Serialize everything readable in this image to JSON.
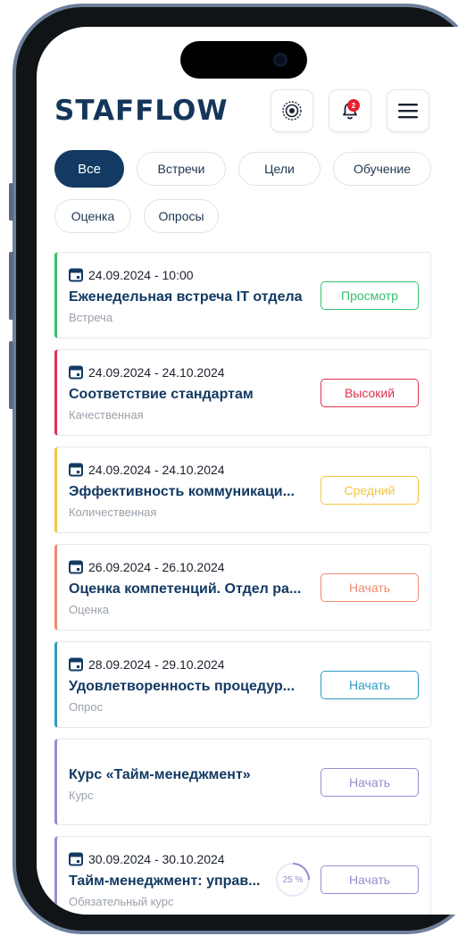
{
  "header": {
    "logo": "STAFFLOW",
    "notification_count": "2"
  },
  "filters": [
    {
      "label": "Все",
      "active": true
    },
    {
      "label": "Встречи",
      "active": false
    },
    {
      "label": "Цели",
      "active": false
    },
    {
      "label": "Обучение",
      "active": false
    },
    {
      "label": "Оценка",
      "active": false
    },
    {
      "label": "Опросы",
      "active": false
    }
  ],
  "cards": [
    {
      "date": "24.09.2024 - 10:00",
      "title": "Еженедельная встреча IT отдела",
      "subtitle": "Встреча",
      "action": "Просмотр",
      "accent": "#35c06d",
      "action_color": "#35c06d"
    },
    {
      "date": "24.09.2024 - 24.10.2024",
      "title": "Соответствие стандартам",
      "subtitle": "Качественная",
      "action": "Высокий",
      "accent": "#e0304f",
      "action_color": "#e0304f"
    },
    {
      "date": "24.09.2024 - 24.10.2024",
      "title": "Эффективность коммуникаци...",
      "subtitle": "Количественная",
      "action": "Средний",
      "accent": "#f4c542",
      "action_color": "#f4c542"
    },
    {
      "date": "26.09.2024 - 26.10.2024",
      "title": "Оценка компетенций. Отдел ра...",
      "subtitle": "Оценка",
      "action": "Начать",
      "accent": "#f08a70",
      "action_color": "#f08a70"
    },
    {
      "date": "28.09.2024 - 29.10.2024",
      "title": "Удовлетворенность процедур...",
      "subtitle": "Опрос",
      "action": "Начать",
      "accent": "#2f9bc4",
      "action_color": "#2f9bc4"
    },
    {
      "date": "",
      "title": "Курс «Тайм-менеджмент»",
      "subtitle": "Курс",
      "action": "Начать",
      "accent": "#9b8ad1",
      "action_color": "#9b8ad1"
    },
    {
      "date": "30.09.2024 - 30.10.2024",
      "title": "Тайм-менеджмент: управ...",
      "subtitle": "Обязательный курс",
      "action": "Начать",
      "accent": "#9b8ad1",
      "action_color": "#9b8ad1",
      "progress": "25 %",
      "progress_value": 0.25
    }
  ],
  "icons": {
    "settings": "target-settings-icon",
    "notifications": "bell-icon",
    "menu": "hamburger-menu-icon",
    "date": "calendar-icon"
  }
}
